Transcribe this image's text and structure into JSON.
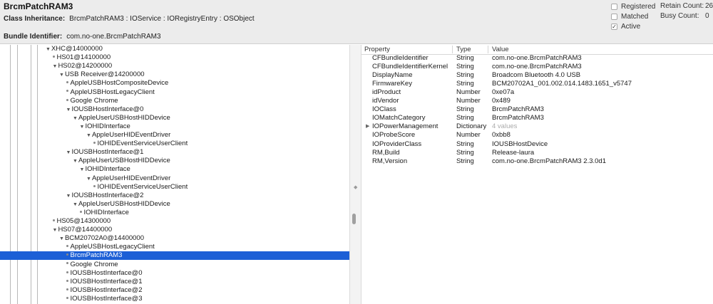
{
  "header": {
    "title": "BrcmPatchRAM3",
    "class_inheritance_label": "Class Inheritance:",
    "class_inheritance_value": "BrcmPatchRAM3 : IOService : IORegistryEntry : OSObject",
    "bundle_identifier_label": "Bundle Identifier:",
    "bundle_identifier_value": "com.no-one.BrcmPatchRAM3",
    "checks": [
      {
        "label": "Registered",
        "checked": false
      },
      {
        "label": "Matched",
        "checked": false
      },
      {
        "label": "Active",
        "checked": true
      }
    ],
    "retain_count_label": "Retain Count:",
    "retain_count_value": "26",
    "busy_count_label": "Busy Count:",
    "busy_count_value": "0"
  },
  "tree": [
    {
      "label": "XHC@14000000",
      "depth": 4,
      "kind": "open"
    },
    {
      "label": "HS01@14100000",
      "depth": 5,
      "kind": "leaf"
    },
    {
      "label": "HS02@14200000",
      "depth": 5,
      "kind": "open"
    },
    {
      "label": "USB Receiver@14200000",
      "depth": 6,
      "kind": "open"
    },
    {
      "label": "AppleUSBHostCompositeDevice",
      "depth": 7,
      "kind": "leaf"
    },
    {
      "label": "AppleUSBHostLegacyClient",
      "depth": 7,
      "kind": "leaf"
    },
    {
      "label": "Google Chrome",
      "depth": 7,
      "kind": "leaf"
    },
    {
      "label": "IOUSBHostInterface@0",
      "depth": 7,
      "kind": "open"
    },
    {
      "label": "AppleUserUSBHostHIDDevice",
      "depth": 8,
      "kind": "open"
    },
    {
      "label": "IOHIDInterface",
      "depth": 9,
      "kind": "open"
    },
    {
      "label": "AppleUserHIDEventDriver",
      "depth": 10,
      "kind": "open"
    },
    {
      "label": "IOHIDEventServiceUserClient",
      "depth": 11,
      "kind": "leaf"
    },
    {
      "label": "IOUSBHostInterface@1",
      "depth": 7,
      "kind": "open"
    },
    {
      "label": "AppleUserUSBHostHIDDevice",
      "depth": 8,
      "kind": "open"
    },
    {
      "label": "IOHIDInterface",
      "depth": 9,
      "kind": "open"
    },
    {
      "label": "AppleUserHIDEventDriver",
      "depth": 10,
      "kind": "open"
    },
    {
      "label": "IOHIDEventServiceUserClient",
      "depth": 11,
      "kind": "leaf"
    },
    {
      "label": "IOUSBHostInterface@2",
      "depth": 7,
      "kind": "open"
    },
    {
      "label": "AppleUserUSBHostHIDDevice",
      "depth": 8,
      "kind": "open"
    },
    {
      "label": "IOHIDInterface",
      "depth": 9,
      "kind": "leaf"
    },
    {
      "label": "HS05@14300000",
      "depth": 5,
      "kind": "leaf"
    },
    {
      "label": "HS07@14400000",
      "depth": 5,
      "kind": "open"
    },
    {
      "label": "BCM20702A0@14400000",
      "depth": 6,
      "kind": "open"
    },
    {
      "label": "AppleUSBHostLegacyClient",
      "depth": 7,
      "kind": "leaf"
    },
    {
      "label": "BrcmPatchRAM3",
      "depth": 7,
      "kind": "leaf",
      "selected": true
    },
    {
      "label": "Google Chrome",
      "depth": 7,
      "kind": "leaf"
    },
    {
      "label": "IOUSBHostInterface@0",
      "depth": 7,
      "kind": "leaf"
    },
    {
      "label": "IOUSBHostInterface@1",
      "depth": 7,
      "kind": "leaf"
    },
    {
      "label": "IOUSBHostInterface@2",
      "depth": 7,
      "kind": "leaf"
    },
    {
      "label": "IOUSBHostInterface@3",
      "depth": 7,
      "kind": "leaf"
    }
  ],
  "properties": {
    "columns": [
      "Property",
      "Type",
      "Value"
    ],
    "rows": [
      {
        "property": "CFBundleIdentifier",
        "type": "String",
        "value": "com.no-one.BrcmPatchRAM3"
      },
      {
        "property": "CFBundleIdentifierKernel",
        "type": "String",
        "value": "com.no-one.BrcmPatchRAM3"
      },
      {
        "property": "DisplayName",
        "type": "String",
        "value": "Broadcom Bluetooth 4.0 USB"
      },
      {
        "property": "FirmwareKey",
        "type": "String",
        "value": "BCM20702A1_001.002.014.1483.1651_v5747"
      },
      {
        "property": "idProduct",
        "type": "Number",
        "value": "0xe07a"
      },
      {
        "property": "idVendor",
        "type": "Number",
        "value": "0x489"
      },
      {
        "property": "IOClass",
        "type": "String",
        "value": "BrcmPatchRAM3"
      },
      {
        "property": "IOMatchCategory",
        "type": "String",
        "value": "BrcmPatchRAM3"
      },
      {
        "property": "IOPowerManagement",
        "type": "Dictionary",
        "value": "4 values",
        "expandable": true
      },
      {
        "property": "IOProbeScore",
        "type": "Number",
        "value": "0xbb8"
      },
      {
        "property": "IOProviderClass",
        "type": "String",
        "value": "IOUSBHostDevice"
      },
      {
        "property": "RM,Build",
        "type": "String",
        "value": "Release-laura"
      },
      {
        "property": "RM,Version",
        "type": "String",
        "value": "com.no-one.BrcmPatchRAM3 2.3.0d1"
      }
    ]
  }
}
